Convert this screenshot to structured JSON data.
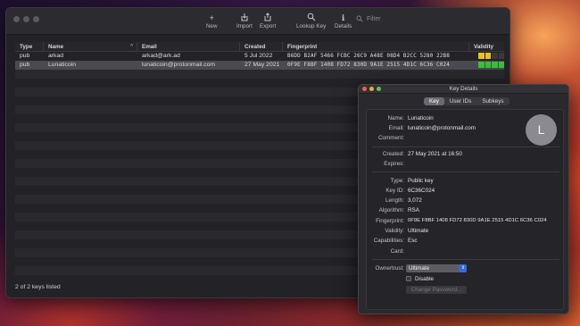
{
  "main": {
    "toolbar": {
      "new_label": "New",
      "import_label": "Import",
      "export_label": "Export",
      "lookup_label": "Lookup Key",
      "details_label": "Details",
      "search_placeholder": "Filter"
    },
    "columns": {
      "type": "Type",
      "name": "Name",
      "email": "Email",
      "created": "Created",
      "fingerprint": "Fingerprint",
      "validity": "Validity"
    },
    "rows": [
      {
        "type": "pub",
        "name": "arkad",
        "email": "arkad@ark.ad",
        "created": "5 Jul 2022",
        "fingerprint": "B6DD B2AF 5466 FCBC 26C9  A48E 08D4 B2CC 5280 22B8",
        "validity_colors": [
          "#e8c21e",
          "#e8c21e",
          "#3a393d",
          "#3a393d"
        ]
      },
      {
        "type": "pub",
        "name": "Lunaticoin",
        "email": "lunaticoin@protonmail.com",
        "created": "27 May 2021",
        "fingerprint": "0F9E F8BF 1408 FD72 830D  9A1E 2515 4D1C 6C36 C024",
        "validity_colors": [
          "#36c23a",
          "#36c23a",
          "#36c23a",
          "#36c23a"
        ]
      }
    ],
    "status": "2 of 2 keys listed"
  },
  "details": {
    "window_title": "Key Details",
    "tabs": [
      "Key",
      "User IDs",
      "Subkeys"
    ],
    "active_tab": "Key",
    "avatar_letter": "L",
    "labels": {
      "name": "Name:",
      "email": "Email:",
      "comment": "Comment:",
      "created": "Created:",
      "expires": "Expires:",
      "type": "Type:",
      "key_id": "Key ID:",
      "length": "Length:",
      "algorithm": "Algorithm:",
      "fingerprint": "Fingerprint:",
      "validity": "Validity:",
      "capabilities": "Capabilities:",
      "card": "Card:",
      "ownertrust": "Ownertrust:"
    },
    "values": {
      "name": "Lunaticoin",
      "email": "lunaticoin@protonmail.com",
      "comment": "",
      "created": "27 May 2021 at 16:50",
      "expires": "",
      "type": "Public key",
      "key_id": "6C36C024",
      "length": "3,072",
      "algorithm": "RSA",
      "fingerprint": "0F9E F8BF 1408 FD72 830D  9A1E 2515 4D1C 6C36 C024",
      "validity": "Ultimate",
      "capabilities": "Esc",
      "card": ""
    },
    "ownertrust_value": "Ultimate",
    "disable_label": "Disable",
    "change_password_label": "Change Password..."
  }
}
